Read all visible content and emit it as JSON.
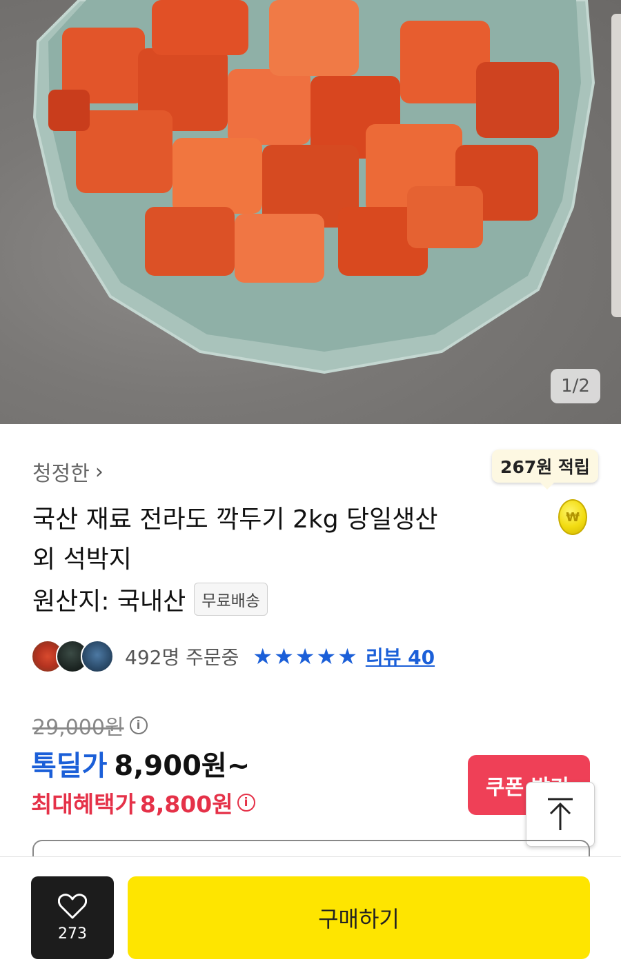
{
  "image": {
    "page_indicator": "1/2"
  },
  "seller": {
    "name": "청정한",
    "chevron": "chevron-right-icon"
  },
  "reward": {
    "label": "267원 적립",
    "coin_symbol": "₩"
  },
  "product": {
    "title_line1": "국산 재료 전라도 깍두기 2kg 당일생산",
    "title_line2": "외 석박지",
    "origin": "원산지: 국내산",
    "shipping_badge": "무료배송"
  },
  "social": {
    "order_count": "492명 주문중",
    "rating_stars": 5,
    "review_link": "리뷰 40"
  },
  "price": {
    "original": "29,000원",
    "deal_label": "톡딜가",
    "deal_price": "8,900원~",
    "max_label": "최대혜택가",
    "max_price": "8,800원"
  },
  "buttons": {
    "coupon": "쿠폰 받기",
    "like_count": "273",
    "buy": "구매하기"
  },
  "colors": {
    "accent_blue": "#1b5fd8",
    "accent_red": "#ef4057",
    "buy_yellow": "#fee500"
  }
}
